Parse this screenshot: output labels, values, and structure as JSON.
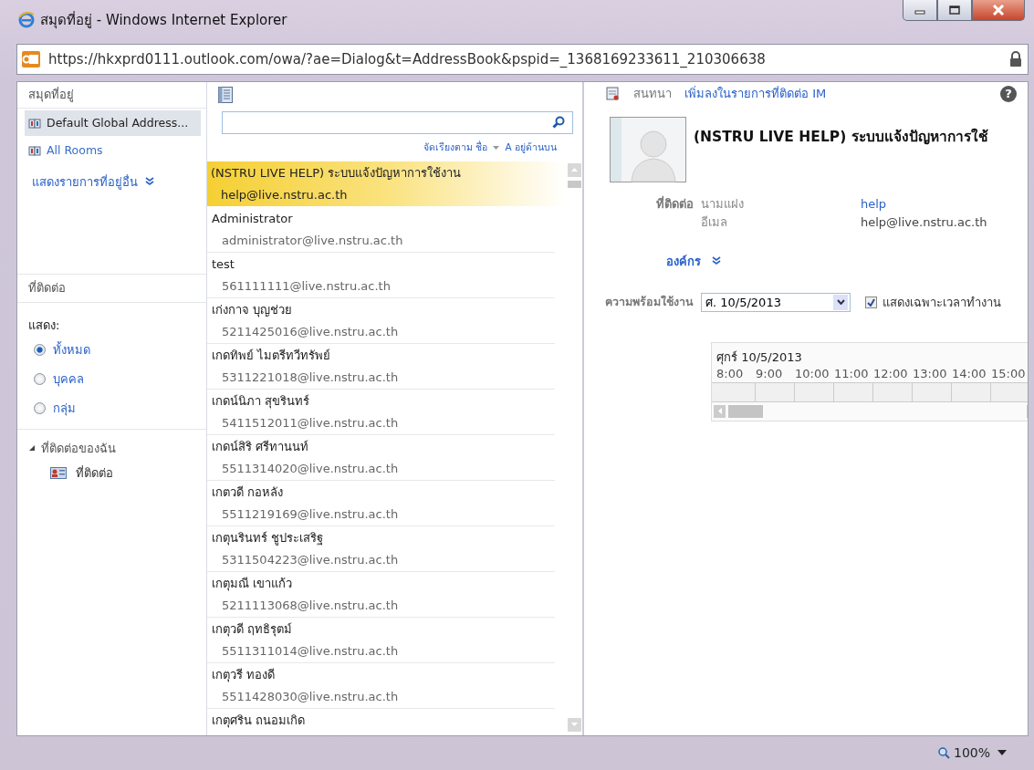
{
  "window": {
    "title": "สมุดที่อยู่ - Windows Internet Explorer",
    "url": "https://hkxprd0111.outlook.com/owa/?ae=Dialog&t=AddressBook&pspid=_1368169233611_210306638"
  },
  "sidebar": {
    "header": "สมุดที่อยู่",
    "books": [
      {
        "label": "Default Global Address...",
        "selected": true
      },
      {
        "label": "All Rooms",
        "selected": false
      }
    ],
    "more_link": "แสดงรายการที่อยู่อื่น",
    "contacts_header": "ที่ติดต่อ",
    "show_label": "แสดง:",
    "filters": [
      {
        "label": "ทั้งหมด",
        "selected": true
      },
      {
        "label": "บุคคล",
        "selected": false
      },
      {
        "label": "กลุ่ม",
        "selected": false
      }
    ],
    "my_contacts": {
      "label": "ที่ติดต่อของฉัน",
      "expanded": true,
      "children": [
        {
          "label": "ที่ติดต่อ"
        }
      ]
    }
  },
  "list": {
    "sort_label": "จัดเรียงตาม ชื่อ",
    "order_label": "A อยู่ด้านบน",
    "items": [
      {
        "name": "(NSTRU LIVE HELP) ระบบแจ้งปัญหาการใช้งาน",
        "email": "help@live.nstru.ac.th",
        "selected": true
      },
      {
        "name": "Administrator",
        "email": "administrator@live.nstru.ac.th",
        "selected": false
      },
      {
        "name": "test",
        "email": "561111111@live.nstru.ac.th",
        "selected": false
      },
      {
        "name": "เก่งกาจ บุญช่วย",
        "email": "5211425016@live.nstru.ac.th",
        "selected": false
      },
      {
        "name": "เกดทิพย์ ไมตรีทวีทรัพย์",
        "email": "5311221018@live.nstru.ac.th",
        "selected": false
      },
      {
        "name": "เกดน์นิภา สุขรินทร์",
        "email": "5411512011@live.nstru.ac.th",
        "selected": false
      },
      {
        "name": "เกดน์สิริ ศรีทานนท์",
        "email": "5511314020@live.nstru.ac.th",
        "selected": false
      },
      {
        "name": "เกตวดี กอหลัง",
        "email": "5511219169@live.nstru.ac.th",
        "selected": false
      },
      {
        "name": "เกตุนรินทร์ ชูประเสริฐ",
        "email": "5311504223@live.nstru.ac.th",
        "selected": false
      },
      {
        "name": "เกตุมณี เขาแก้ว",
        "email": "5211113068@live.nstru.ac.th",
        "selected": false
      },
      {
        "name": "เกตุวดี ฤทธิรุตม์",
        "email": "5511311014@live.nstru.ac.th",
        "selected": false
      },
      {
        "name": "เกตุวรี ทองดี",
        "email": "5511428030@live.nstru.ac.th",
        "selected": false
      },
      {
        "name": "เกตุศริน ถนอมเกิด",
        "selected": false
      }
    ]
  },
  "detail": {
    "chat": "สนทนา",
    "add_im": "เพิ่มลงในรายการที่ติดต่อ IM",
    "help": "?",
    "name": "(NSTRU LIVE HELP) ระบบแจ้งปัญหาการใช้",
    "contact_label": "ที่ติดต่อ",
    "fields": [
      {
        "label": "นามแฝง",
        "value": "help",
        "kind": "link"
      },
      {
        "label": "อีเมล",
        "value": "help@live.nstru.ac.th",
        "kind": "text"
      }
    ],
    "org_label": "องค์กร",
    "availability_label": "ความพร้อมใช้งาน",
    "date": "ศ. 10/5/2013",
    "working_hours": {
      "label": "แสดงเฉพาะเวลาทำงาน",
      "checked": true
    },
    "schedule": {
      "day": "ศุกร์ 10/5/2013",
      "hours": [
        "8:00",
        "9:00",
        "10:00",
        "11:00",
        "12:00",
        "13:00",
        "14:00",
        "15:00"
      ]
    }
  },
  "status_bar": {
    "zoom": "100%"
  }
}
